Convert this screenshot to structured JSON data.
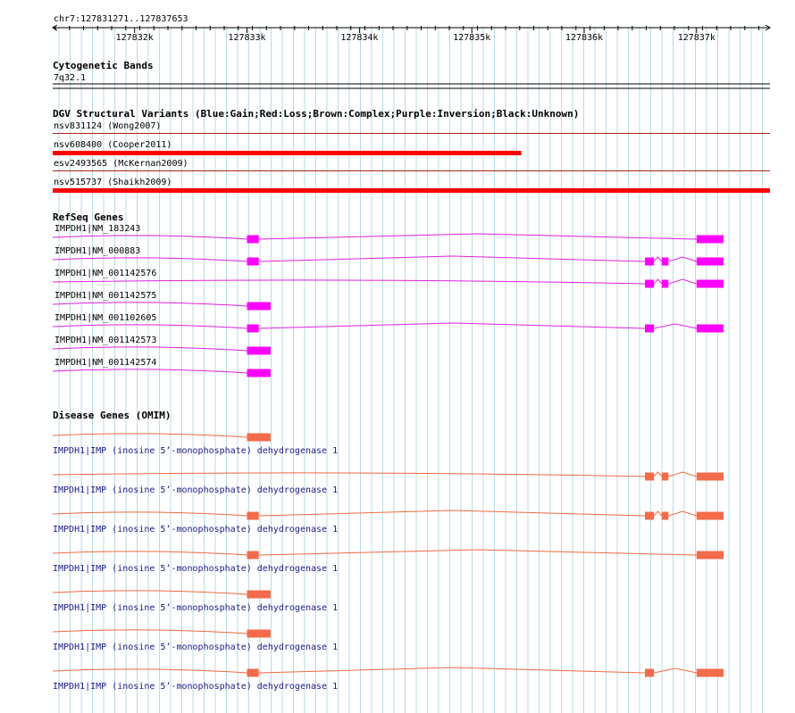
{
  "colors": {
    "grid": "#b7dbe6",
    "refseq": "#e020e0",
    "refseq_exon": "#ff00ff",
    "omim": "#ee6a40",
    "omim_exon": "#f36b4a",
    "cnv_loss": "#ff0000",
    "cnv_line": "#aa2222",
    "axis": "#000000",
    "omim_text": "#1a1a8a"
  },
  "ruler": {
    "region": "chr7:127831271..127837653",
    "ticks": [
      "127832k",
      "127833k",
      "127834k",
      "127835k",
      "127836k",
      "127837k"
    ]
  },
  "cytoband": {
    "title": "Cytogenetic Bands",
    "band": "7q32.1"
  },
  "dgv": {
    "title": "DGV Structural Variants (Blue:Gain;Red:Loss;Brown:Complex;Purple:Inversion;Black:Unknown)",
    "variants": [
      {
        "label": "nsv831124 (Wong2007)",
        "type": "Loss",
        "bar": false,
        "end": 127837653
      },
      {
        "label": "nsv608400 (Cooper2011)",
        "type": "Loss",
        "bar": true,
        "end": 127835440
      },
      {
        "label": "esv2493565 (McKernan2009)",
        "type": "Loss",
        "bar": false,
        "end": 127837653
      },
      {
        "label": "nsv515737 (Shaikh2009)",
        "type": "Loss",
        "bar": true,
        "end": 127837653
      }
    ]
  },
  "refseq": {
    "title": "RefSeq Genes",
    "transcripts": [
      {
        "label": "IMPDH1|NM_183243",
        "exons": [
          [
            127833000,
            127833105
          ],
          [
            127837000,
            127837240
          ]
        ]
      },
      {
        "label": "IMPDH1|NM_000883",
        "exons": [
          [
            127833000,
            127833105
          ],
          [
            127836540,
            127836620
          ],
          [
            127836690,
            127836750
          ],
          [
            127837000,
            127837240
          ]
        ]
      },
      {
        "label": "IMPDH1|NM_001142576",
        "exons": [
          [
            127836540,
            127836620
          ],
          [
            127836690,
            127836750
          ],
          [
            127837000,
            127837240
          ]
        ]
      },
      {
        "label": "IMPDH1|NM_001142575",
        "exons": [
          [
            127833000,
            127833210
          ]
        ]
      },
      {
        "label": "IMPDH1|NM_001102605",
        "exons": [
          [
            127833000,
            127833105
          ],
          [
            127836540,
            127836620
          ],
          [
            127837000,
            127837240
          ]
        ]
      },
      {
        "label": "IMPDH1|NM_001142573",
        "exons": [
          [
            127833000,
            127833210
          ]
        ]
      },
      {
        "label": "IMPDH1|NM_001142574",
        "exons": [
          [
            127833000,
            127833210
          ]
        ]
      }
    ]
  },
  "omim": {
    "title": "Disease Genes (OMIM)",
    "label": "IMPDH1|IMP (inosine 5’-monophosphate) dehydrogenase 1",
    "genes": [
      {
        "exons": [
          [
            127833000,
            127833210
          ]
        ]
      },
      {
        "exons": [
          [
            127836540,
            127836620
          ],
          [
            127836690,
            127836750
          ],
          [
            127837000,
            127837240
          ]
        ]
      },
      {
        "exons": [
          [
            127833000,
            127833105
          ],
          [
            127836540,
            127836620
          ],
          [
            127836690,
            127836750
          ],
          [
            127837000,
            127837240
          ]
        ]
      },
      {
        "exons": [
          [
            127833000,
            127833105
          ],
          [
            127837000,
            127837240
          ]
        ]
      },
      {
        "exons": [
          [
            127833000,
            127833210
          ]
        ]
      },
      {
        "exons": [
          [
            127833000,
            127833210
          ]
        ]
      },
      {
        "exons": [
          [
            127833000,
            127833105
          ],
          [
            127836540,
            127836620
          ],
          [
            127837000,
            127837240
          ]
        ]
      }
    ]
  }
}
